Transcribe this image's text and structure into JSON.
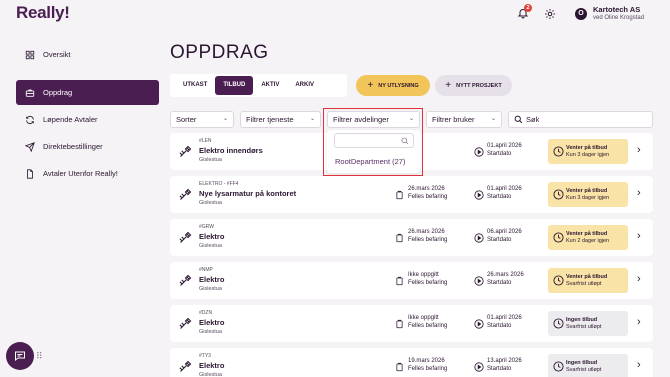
{
  "app": {
    "logo": "Really!"
  },
  "header": {
    "notification_count": "2",
    "company": "Kartotech AS",
    "user": "ved Oline Krogstad",
    "avatar_initial": "O"
  },
  "sidebar": {
    "items": [
      {
        "label": "Oversikt",
        "icon": "grid-icon",
        "active": false
      },
      {
        "label": "Oppdrag",
        "icon": "briefcase-icon",
        "active": true
      },
      {
        "label": "Løpende Avtaler",
        "icon": "refresh-icon",
        "active": false
      },
      {
        "label": "Direktebestillinger",
        "icon": "send-icon",
        "active": false
      },
      {
        "label": "Avtaler Utenfor Really!",
        "icon": "document-icon",
        "active": false
      }
    ]
  },
  "main": {
    "title": "OPPDRAG",
    "tabs": [
      {
        "label": "UTKAST",
        "active": false
      },
      {
        "label": "TILBUD",
        "active": true
      },
      {
        "label": "AKTIV",
        "active": false
      },
      {
        "label": "ARKIV",
        "active": false
      }
    ],
    "new_tender_label": "NY UTLYSNING",
    "new_project_label": "NYTT PROSJEKT",
    "filters": {
      "sort": "Sorter",
      "services": "Filtrer tjeneste",
      "departments": "Filtrer avdelinger",
      "users": "Filtrer bruker",
      "search_placeholder": "Søk"
    },
    "department_dropdown": {
      "search_value": "",
      "options": [
        "RootDepartment (27)"
      ]
    },
    "cards": [
      {
        "num": "#LEN",
        "name": "Elektro innendørs",
        "loc": "Gislestua",
        "date1": "",
        "label1": "",
        "date2": "01.april 2026",
        "label2": "Startdato",
        "status1": "Venter på tilbud",
        "status2": "Kun 3 dager igjen",
        "status_color": "yellow"
      },
      {
        "num": "ELEKTRO - #FF4",
        "name": "Nye lysarmatur på kontoret",
        "loc": "Gislestua",
        "date1": "26.mars 2026",
        "label1": "Felles befaring",
        "date2": "01.april 2026",
        "label2": "Startdato",
        "status1": "Venter på tilbud",
        "status2": "Kun 3 dager igjen",
        "status_color": "yellow"
      },
      {
        "num": "#GRW",
        "name": "Elektro",
        "loc": "Gislestua",
        "date1": "26.mars 2026",
        "label1": "Felles befaring",
        "date2": "06.april 2026",
        "label2": "Startdato",
        "status1": "Venter på tilbud",
        "status2": "Kun 2 dager igjen",
        "status_color": "yellow"
      },
      {
        "num": "#NMP",
        "name": "Elektro",
        "loc": "Gislestua",
        "date1": "Ikke oppgitt",
        "label1": "Felles befaring",
        "date2": "26.mars 2026",
        "label2": "Startdato",
        "status1": "Venter på tilbud",
        "status2": "Svarfrist utløpt",
        "status_color": "yellow"
      },
      {
        "num": "#DZN",
        "name": "Elektro",
        "loc": "Gislestua",
        "date1": "Ikke oppgitt",
        "label1": "Felles befaring",
        "date2": "01.april 2026",
        "label2": "Startdato",
        "status1": "Ingen tilbud",
        "status2": "Svarfrist utløpt",
        "status_color": "grey"
      },
      {
        "num": "#TY3",
        "name": "Elektro",
        "loc": "Gislestua",
        "date1": "19.mars 2026",
        "label1": "Felles befaring",
        "date2": "13.april 2026",
        "label2": "Startdato",
        "status1": "Ingen tilbud",
        "status2": "Svarfrist utløpt",
        "status_color": "grey"
      }
    ]
  },
  "colors": {
    "brand": "#4a1e51",
    "accent_yellow": "#f2c55a",
    "highlight": "#e0303a"
  }
}
